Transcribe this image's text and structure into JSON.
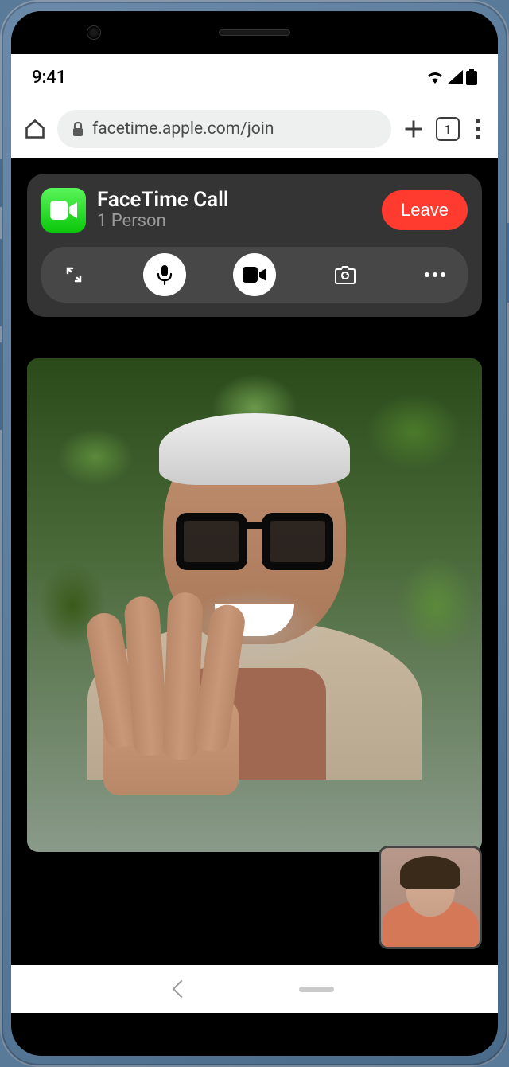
{
  "status": {
    "time": "9:41"
  },
  "browser": {
    "url": "facetime.apple.com/join",
    "tab_count": "1"
  },
  "call": {
    "title": "FaceTime Call",
    "subtitle": "1 Person",
    "leave_label": "Leave"
  }
}
